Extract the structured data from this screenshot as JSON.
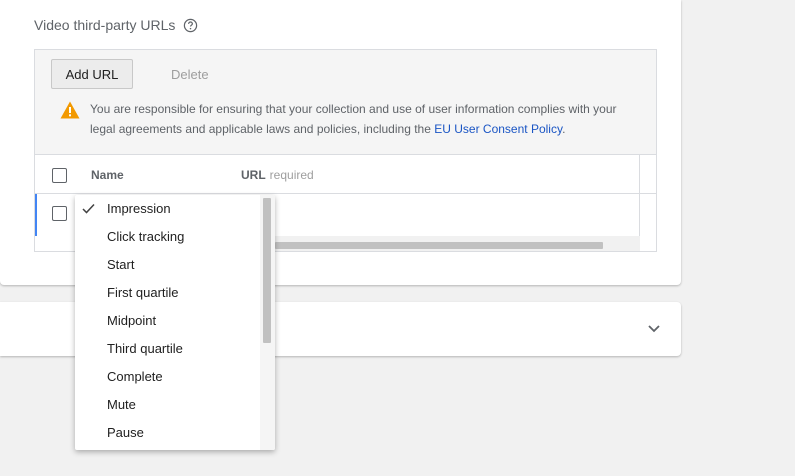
{
  "section": {
    "title": "Video third-party URLs",
    "help_icon": "help-circle-icon"
  },
  "toolbar": {
    "add_label": "Add URL",
    "delete_label": "Delete"
  },
  "warning": {
    "icon": "warning-icon",
    "text": "You are responsible for ensuring that your collection and use of user information complies with your legal agreements and applicable laws and policies, including the ",
    "link_text": "EU User Consent Policy",
    "suffix": "."
  },
  "table": {
    "headers": {
      "name": "Name",
      "url": "URL",
      "url_hint": "required"
    }
  },
  "dropdown": {
    "selected": "Impression",
    "items": [
      {
        "label": "Impression",
        "checked": true
      },
      {
        "label": "Click tracking",
        "checked": false
      },
      {
        "label": "Start",
        "checked": false
      },
      {
        "label": "First quartile",
        "checked": false
      },
      {
        "label": "Midpoint",
        "checked": false
      },
      {
        "label": "Third quartile",
        "checked": false
      },
      {
        "label": "Complete",
        "checked": false
      },
      {
        "label": "Mute",
        "checked": false
      },
      {
        "label": "Pause",
        "checked": false
      }
    ]
  },
  "collapsed_section": {
    "icon": "chevron-down-icon"
  },
  "colors": {
    "accent": "#4285f4",
    "link": "#1a55c4",
    "warning": "#f29900"
  }
}
